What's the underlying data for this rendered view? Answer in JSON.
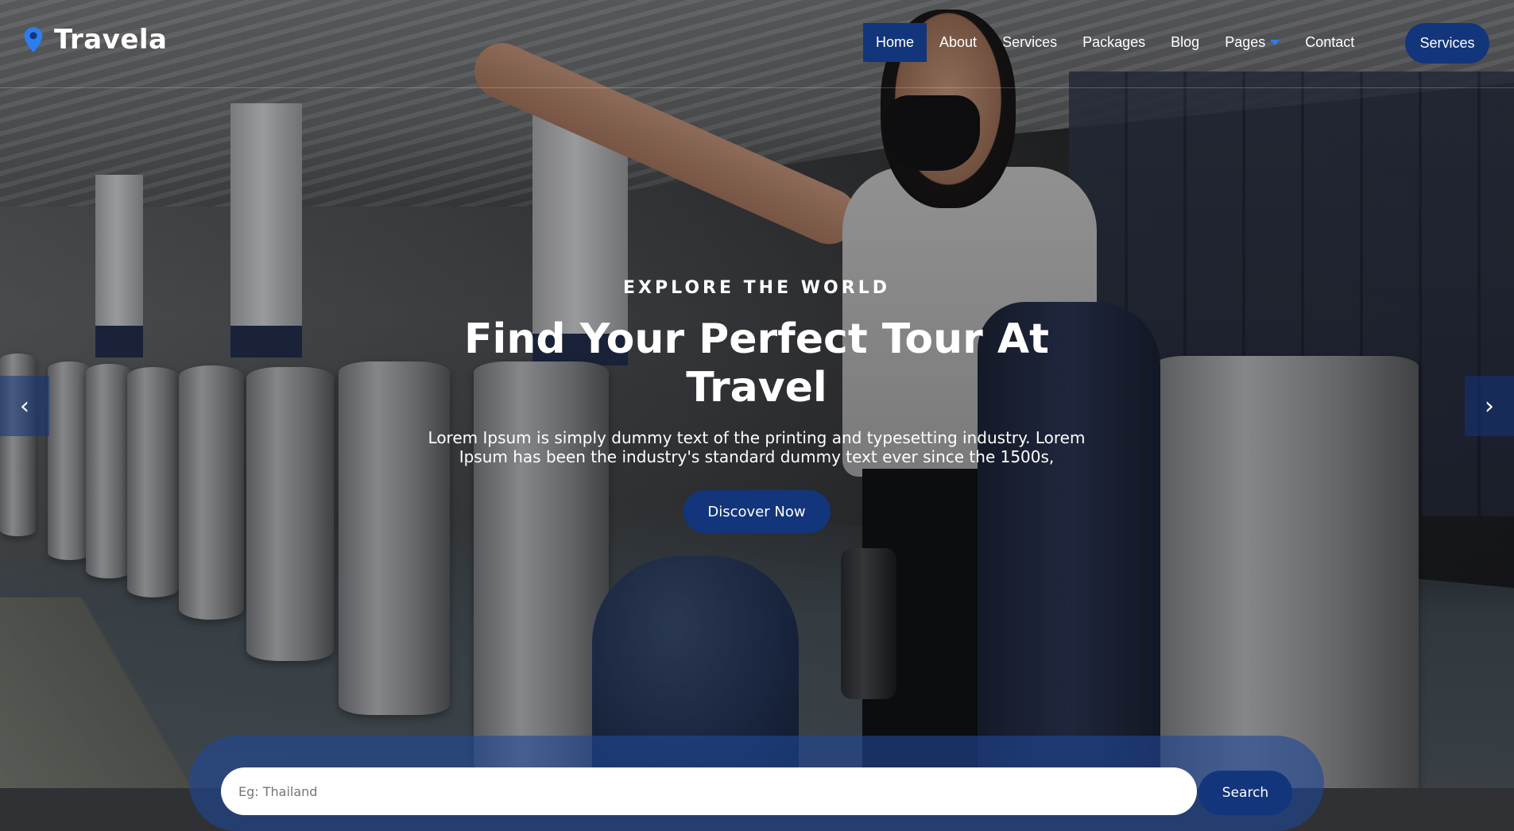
{
  "brand": {
    "name": "Travela",
    "icon": "map-marker-icon",
    "color": "#13357b"
  },
  "nav": {
    "items": [
      {
        "label": "Home",
        "active": true
      },
      {
        "label": "About"
      },
      {
        "label": "Services"
      },
      {
        "label": "Packages"
      },
      {
        "label": "Blog"
      },
      {
        "label": "Pages",
        "dropdown": true
      },
      {
        "label": "Contact"
      }
    ],
    "button_label": "Services"
  },
  "hero": {
    "eyebrow": "EXPLORE THE WORLD",
    "headline": "Find Your Perfect Tour At Travel",
    "lead": "Lorem Ipsum is simply dummy text of the printing and typesetting industry. Lorem Ipsum has been the industry's standard dummy text ever since the 1500s,",
    "cta_label": "Discover Now"
  },
  "carousel": {
    "prev_icon": "chevron-left-icon",
    "next_icon": "chevron-right-icon",
    "prev_glyph": "‹",
    "next_glyph": "›"
  },
  "search": {
    "placeholder": "Eg: Thailand",
    "button_label": "Search"
  },
  "colors": {
    "primary": "#13357b",
    "accent": "#2d7df0"
  }
}
